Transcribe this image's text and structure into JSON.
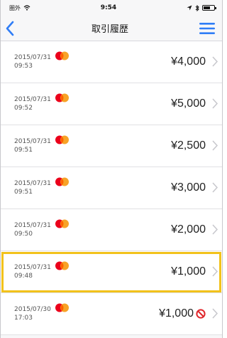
{
  "status": {
    "carrier": "圏外",
    "time": "9:54"
  },
  "header": {
    "title": "取引履歴"
  },
  "transactions": [
    {
      "date": "2015/07/31",
      "time": "09:53",
      "amount": "¥4,000",
      "canceled": false,
      "highlighted": false
    },
    {
      "date": "2015/07/31",
      "time": "09:52",
      "amount": "¥5,000",
      "canceled": false,
      "highlighted": false
    },
    {
      "date": "2015/07/31",
      "time": "09:51",
      "amount": "¥2,500",
      "canceled": false,
      "highlighted": false
    },
    {
      "date": "2015/07/31",
      "time": "09:51",
      "amount": "¥3,000",
      "canceled": false,
      "highlighted": false
    },
    {
      "date": "2015/07/31",
      "time": "09:50",
      "amount": "¥2,000",
      "canceled": false,
      "highlighted": false
    },
    {
      "date": "2015/07/31",
      "time": "09:48",
      "amount": "¥1,000",
      "canceled": false,
      "highlighted": true
    },
    {
      "date": "2015/07/30",
      "time": "17:03",
      "amount": "¥1,000",
      "canceled": true,
      "highlighted": false
    }
  ],
  "icons": {
    "back": "chevron-left-icon",
    "menu": "hamburger-menu-icon",
    "card": "mastercard-icon",
    "row_chevron": "chevron-right-icon",
    "cancel": "prohibited-icon"
  },
  "colors": {
    "accent": "#2f7df6",
    "highlight": "#f2c21b",
    "cancel": "#e0262b",
    "mastercard_red": "#eb001b",
    "mastercard_orange": "#f79e1b"
  }
}
